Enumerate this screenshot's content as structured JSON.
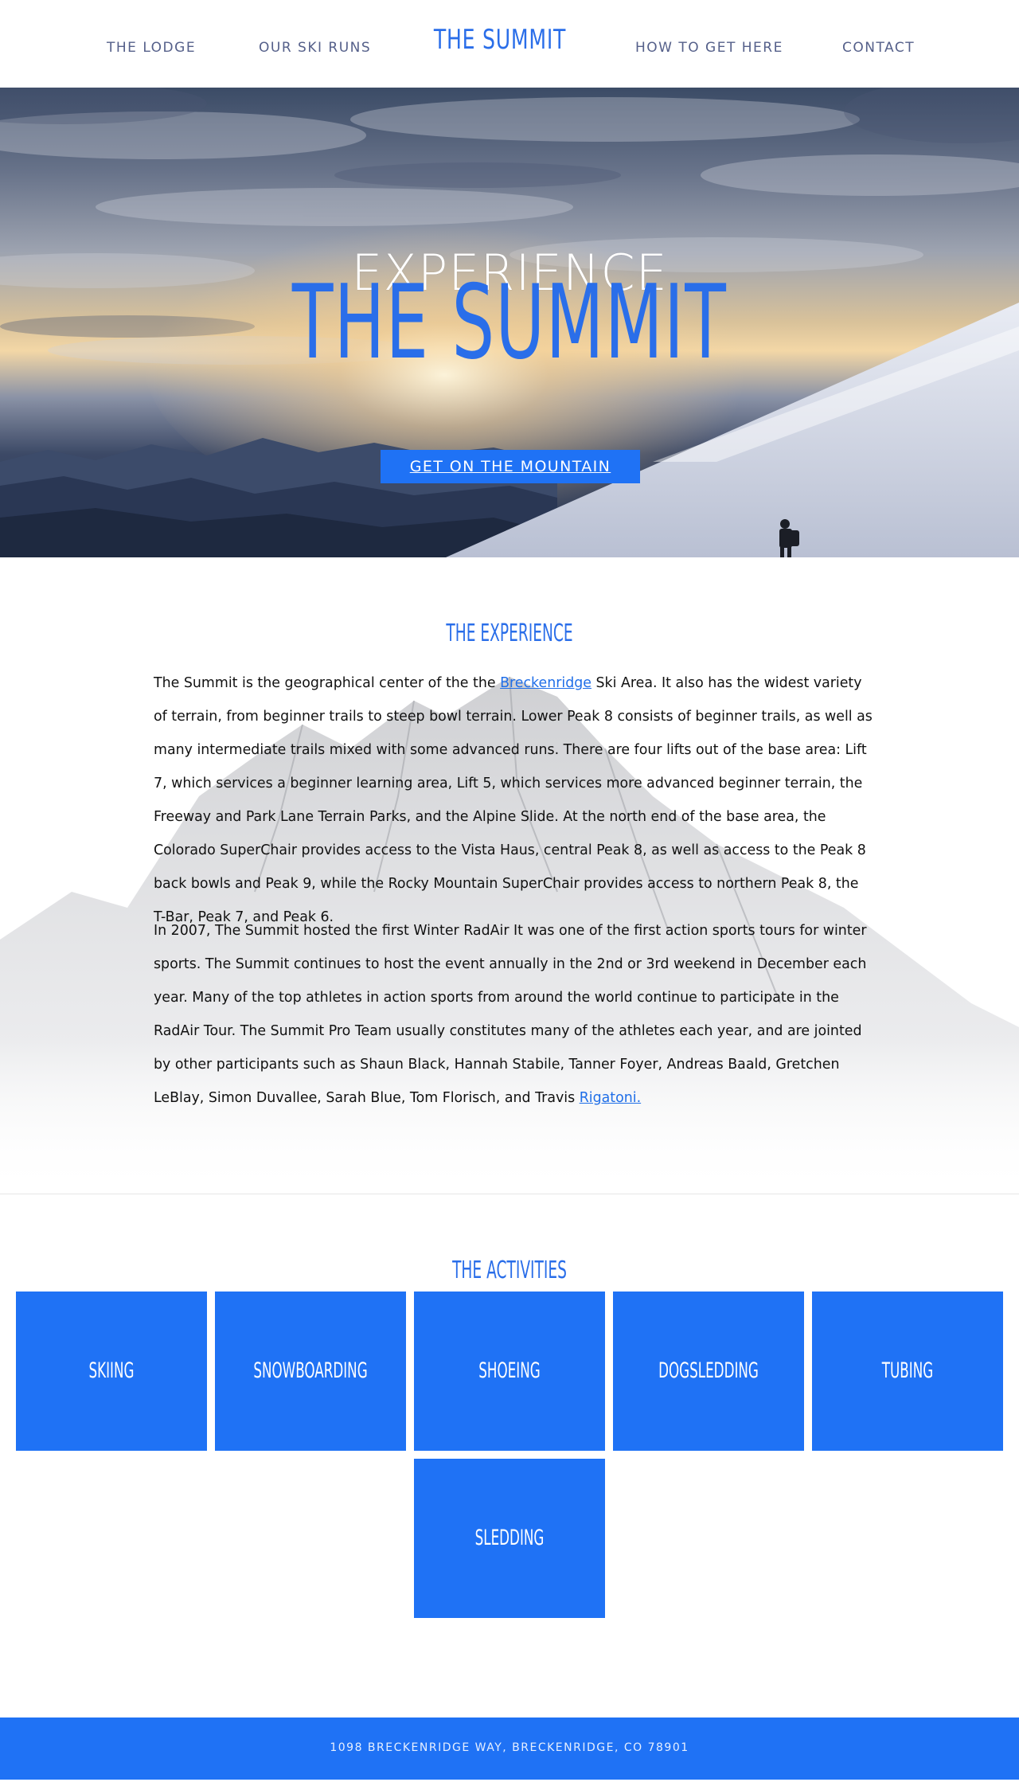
{
  "nav": {
    "items": [
      "THE LODGE",
      "OUR SKI RUNS",
      "HOW TO GET HERE",
      "CONTACT"
    ],
    "brand": "THE SUMMIT"
  },
  "hero": {
    "pre_title": "EXPERIENCE",
    "title": "THE SUMMIT",
    "cta": "GET ON THE MOUNTAIN"
  },
  "experience": {
    "heading": "THE EXPERIENCE",
    "p1_before_link": "The Summit is the geographical center of the the ",
    "p1_link": "Breckenridge",
    "p1_after_link": " Ski Area. It also has the widest variety of terrain, from beginner trails to steep bowl terrain. Lower Peak 8 consists of beginner trails, as well as many intermediate trails mixed with some advanced runs. There are four lifts out of the base area: Lift 7, which services a beginner learning area, Lift 5, which services more advanced beginner terrain, the Freeway and Park Lane Terrain Parks, and the Alpine Slide. At the north end of the base area, the Colorado SuperChair provides access to the Vista Haus, central Peak 8, as well as access to the Peak 8 back bowls and Peak 9, while the Rocky Mountain SuperChair provides access to northern Peak 8, the T-Bar, Peak 7, and Peak 6.",
    "p2_before_link": "In 2007, The Summit hosted the first Winter RadAir It was one of the first action sports tours for winter sports. The Summit continues to host the event annually in the 2nd or 3rd weekend in December each year. Many of the top athletes in action sports from around the world continue to participate in the RadAir Tour. The Summit Pro Team usually constitutes many of the athletes each year, and are jointed by other participants such as Shaun Black, Hannah Stabile, Tanner Foyer, Andreas Baald, Gretchen LeBlay, Simon Duvallee, Sarah Blue, Tom Florisch, and Travis ",
    "p2_link": "Rigatoni."
  },
  "activities": {
    "heading": "THE ACTIVITIES",
    "items": [
      "SKIING",
      "SNOWBOARDING",
      "SHOEING",
      "DOGSLEDDING",
      "TUBING",
      "SLEDDING"
    ]
  },
  "footer": {
    "address": "1098 BRECKENRIDGE WAY, BRECKENRIDGE, CO 78901"
  },
  "colors": {
    "accent": "#1f72f5",
    "nav_text": "#55608a"
  }
}
